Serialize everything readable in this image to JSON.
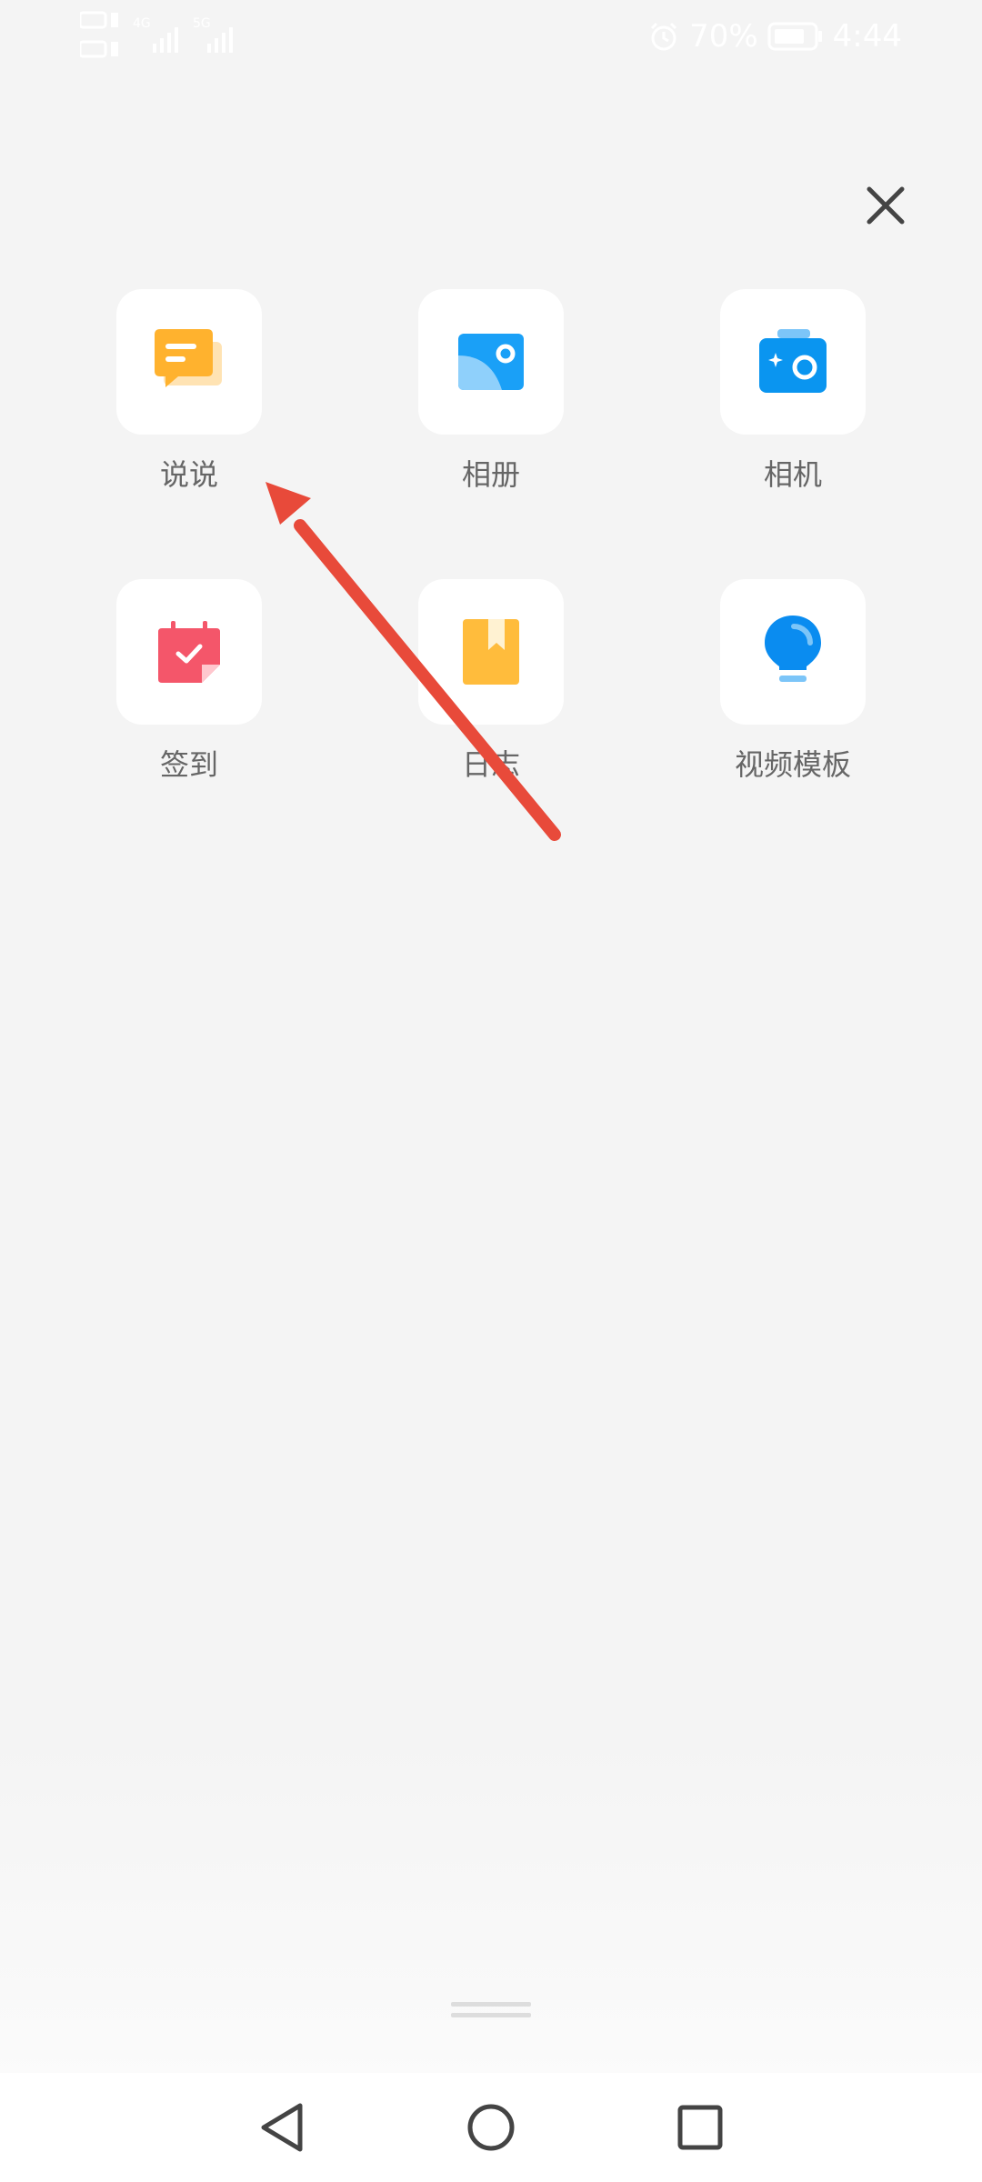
{
  "status_bar": {
    "battery_percent": "70%",
    "time": "4:44",
    "signal_labels": [
      "4G",
      "5G"
    ]
  },
  "close": {
    "icon": "close-icon"
  },
  "menu": {
    "items": [
      {
        "label": "说说",
        "icon": "chat-bubble-icon",
        "color": "#FFB22E"
      },
      {
        "label": "相册",
        "icon": "photo-album-icon",
        "color": "#1AA0F7"
      },
      {
        "label": "相机",
        "icon": "camera-icon",
        "color": "#0A95F0"
      },
      {
        "label": "签到",
        "icon": "calendar-check-icon",
        "color": "#F4566A"
      },
      {
        "label": "日志",
        "icon": "bookmark-book-icon",
        "color": "#FFBC3C"
      },
      {
        "label": "视频模板",
        "icon": "lightbulb-icon",
        "color": "#0A8CF0"
      }
    ]
  },
  "annotation": {
    "color": "#E84A3A",
    "icon": "red-arrow-annotation"
  },
  "nav_bar": {
    "buttons": [
      "back-icon",
      "home-icon",
      "recents-icon"
    ]
  }
}
